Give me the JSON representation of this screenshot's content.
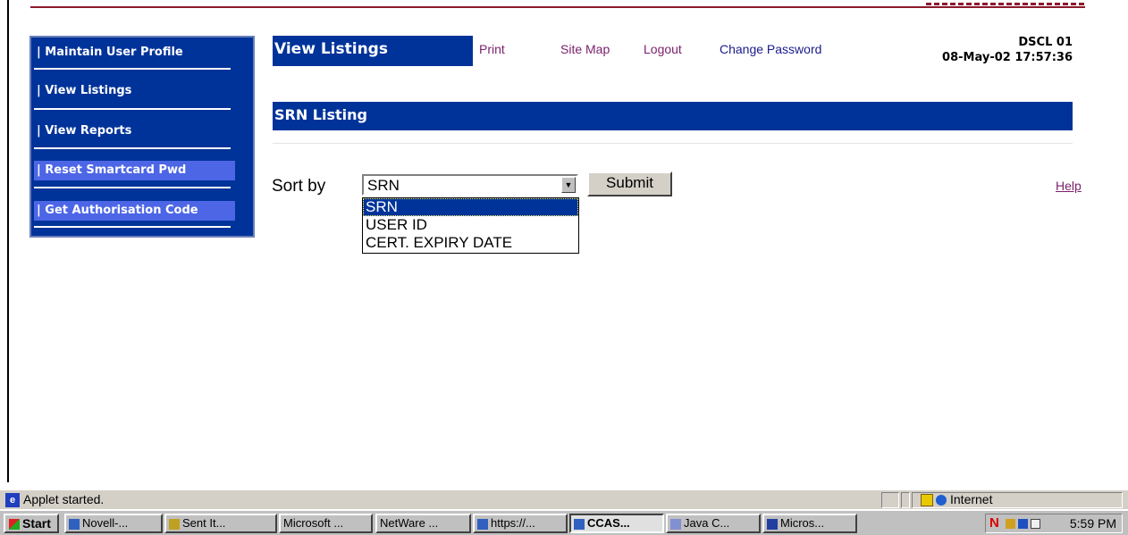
{
  "sidebar": {
    "items": [
      {
        "label": "| Maintain User Profile"
      },
      {
        "label": "| View Listings"
      },
      {
        "label": "| View Reports"
      },
      {
        "label": "| Reset Smartcard Pwd"
      },
      {
        "label": "| Get Authorisation Code"
      }
    ]
  },
  "header": {
    "title": "View Listings",
    "links": {
      "print": "Print",
      "site_map": "Site Map",
      "logout": "Logout",
      "change_password": "Change Password"
    },
    "user_id": "DSCL 01",
    "datetime": "08-May-02 17:57:36"
  },
  "main": {
    "section_title": "SRN Listing",
    "sort_label": "Sort by",
    "sort_value": "SRN",
    "sort_options": [
      "SRN",
      "USER ID",
      "CERT. EXPIRY DATE"
    ],
    "submit_label": "Submit",
    "help_label": "Help"
  },
  "statusbar": {
    "message": "Applet started.",
    "zone": "Internet"
  },
  "taskbar": {
    "start_label": "Start",
    "tasks": [
      {
        "label": "Novell-..."
      },
      {
        "label": "Sent It..."
      },
      {
        "label": "Microsoft ..."
      },
      {
        "label": "NetWare ..."
      },
      {
        "label": "https://..."
      },
      {
        "label": "CCAS..."
      },
      {
        "label": "Java C..."
      },
      {
        "label": "Micros..."
      }
    ],
    "clock": "5:59 PM"
  },
  "colors": {
    "nav_blue": "#003399",
    "highlight_blue": "#4d66e6",
    "link_purple": "#7a1f6b",
    "top_rule": "#8b1a2c"
  }
}
